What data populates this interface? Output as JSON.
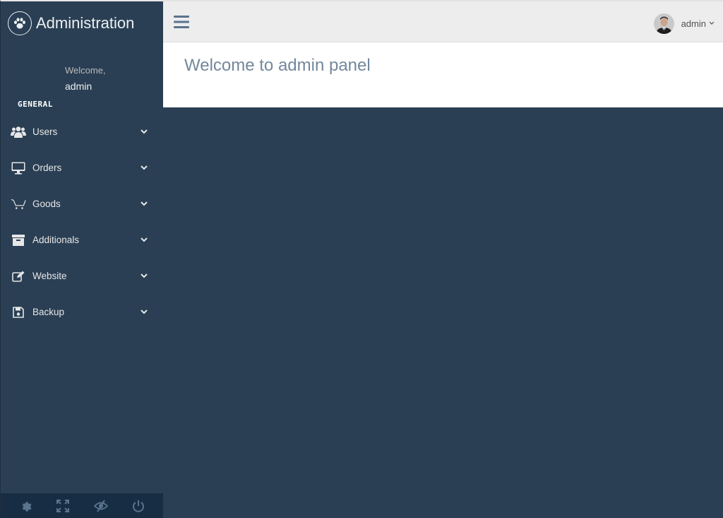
{
  "sidebar": {
    "brand_title": "Administration",
    "brand_icon": "paw-icon",
    "welcome_text": "Welcome,",
    "welcome_name": "admin",
    "section_label": "GENERAL",
    "items": [
      {
        "label": "Users",
        "icon": "users-icon"
      },
      {
        "label": "Orders",
        "icon": "monitor-icon"
      },
      {
        "label": "Goods",
        "icon": "cart-icon"
      },
      {
        "label": "Additionals",
        "icon": "archive-icon"
      },
      {
        "label": "Website",
        "icon": "edit-icon"
      },
      {
        "label": "Backup",
        "icon": "floppy-disk-icon"
      }
    ],
    "footer_icons": [
      "gear-icon",
      "fullscreen-icon",
      "eye-slash-icon",
      "power-icon"
    ]
  },
  "topnav": {
    "menu_toggle_icon": "hamburger-icon",
    "user_name": "admin"
  },
  "content": {
    "title": "Welcome to admin panel"
  },
  "colors": {
    "sidebar_bg": "#2a3f54",
    "sidebar_footer_bg": "#172d44",
    "topnav_bg": "#ededed",
    "title_color": "#73879c",
    "toggle_color": "#5a738e"
  }
}
